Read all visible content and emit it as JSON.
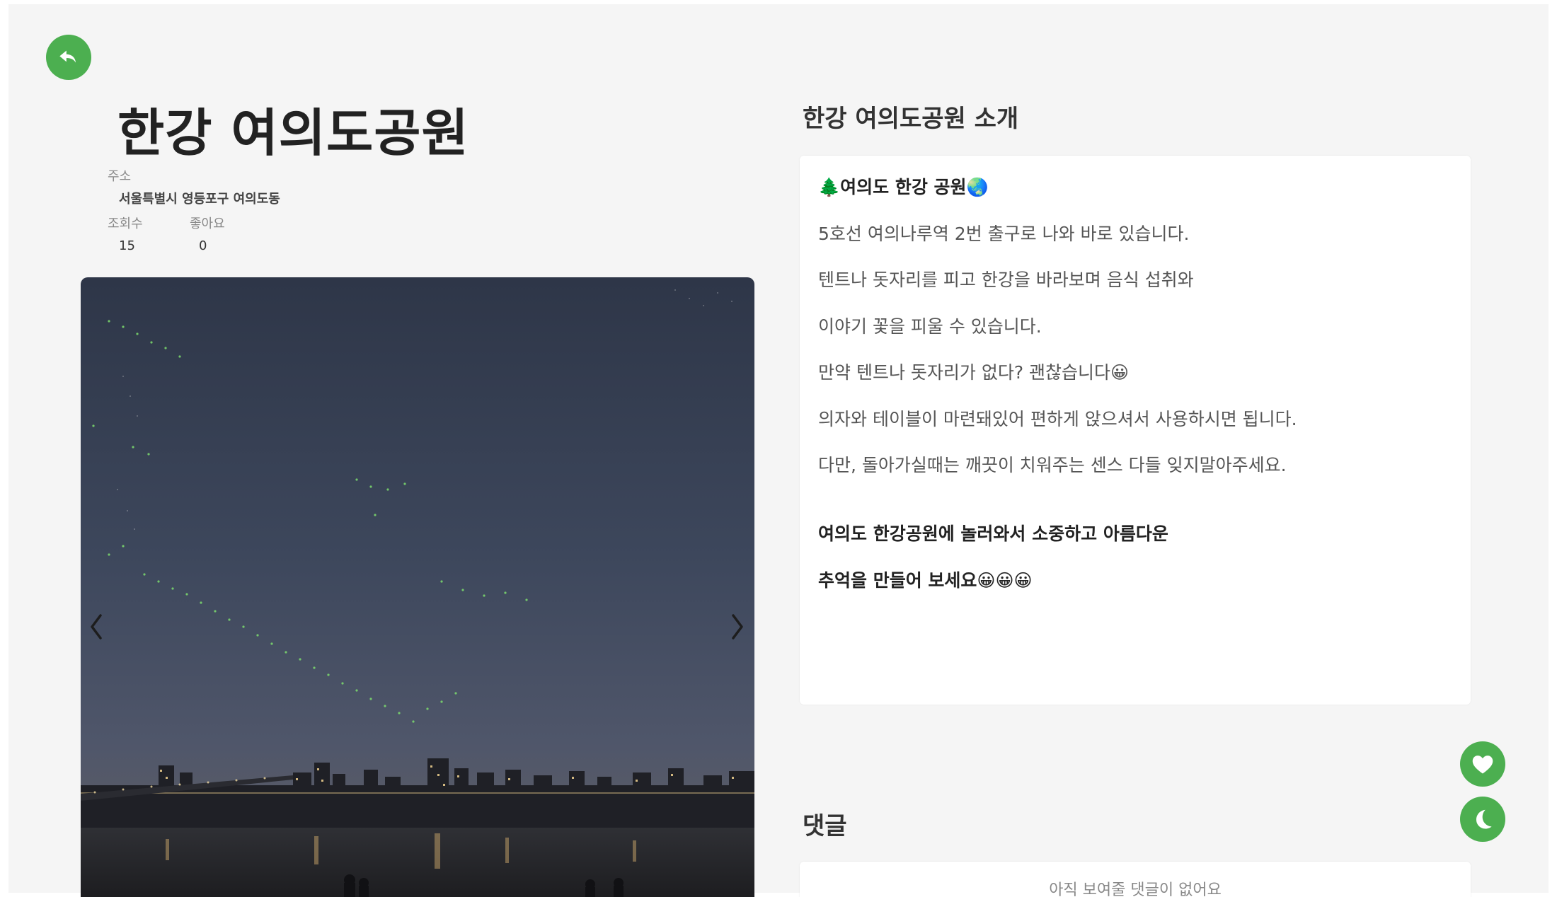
{
  "page": {
    "title": "한강 여의도공원",
    "address_label": "주소",
    "address": "서울특별시 영등포구 여의도동",
    "views_label": "조회수",
    "views": "15",
    "likes_label": "좋아요",
    "likes": "0"
  },
  "icons": {
    "back": "back-arrow-icon",
    "prev": "chevron-left-icon",
    "next": "chevron-right-icon",
    "like": "heart-icon",
    "theme": "moon-icon"
  },
  "colors": {
    "accent": "#4caf50",
    "background": "#f5f5f5",
    "card": "#ffffff"
  },
  "intro": {
    "heading": "한강 여의도공원 소개",
    "lines": [
      "🌲여의도 한강 공원🌏",
      "5호선 여의나루역 2번 출구로 나와 바로 있습니다.",
      "텐트나 돗자리를 피고 한강을 바라보며 음식 섭취와",
      "이야기 꽃을 피울 수 있습니다.",
      "만약 텐트나 돗자리가 없다? 괜찮습니다😀",
      "의자와 테이블이 마련돼있어 편하게 앉으셔서 사용하시면 됩니다.",
      "다만, 돌아가실때는 깨끗이 치워주는 센스 다들 잊지말아주세요.",
      "여의도 한강공원에 놀러와서 소중하고 아름다운",
      "추억을 만들어 보세요😀😀😀"
    ]
  },
  "comments": {
    "heading": "댓글",
    "empty": "아직 보여줄 댓글이 없어요"
  }
}
